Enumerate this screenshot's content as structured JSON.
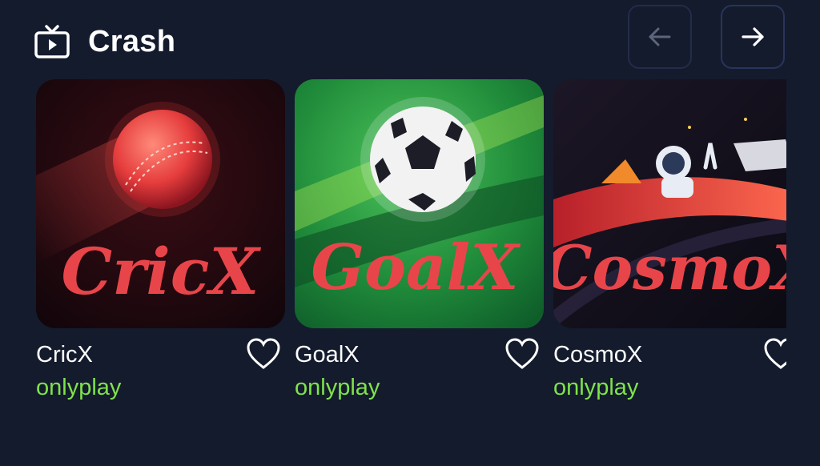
{
  "section": {
    "title": "Crash",
    "icon": "tv-icon"
  },
  "nav": {
    "prev_icon": "arrow-left-icon",
    "next_icon": "arrow-right-icon"
  },
  "games": [
    {
      "name": "CricX",
      "provider": "onlyplay",
      "logo_text": "CricX",
      "favorite_icon": "heart-outline-icon"
    },
    {
      "name": "GoalX",
      "provider": "onlyplay",
      "logo_text": "GoalX",
      "favorite_icon": "heart-outline-icon"
    },
    {
      "name": "CosmoX",
      "provider": "onlyplay",
      "logo_text": "CosmoX",
      "favorite_icon": "heart-outline-icon"
    }
  ],
  "colors": {
    "background": "#141b2d",
    "provider_text": "#7fe34a",
    "logo_red": "#e8454a"
  }
}
